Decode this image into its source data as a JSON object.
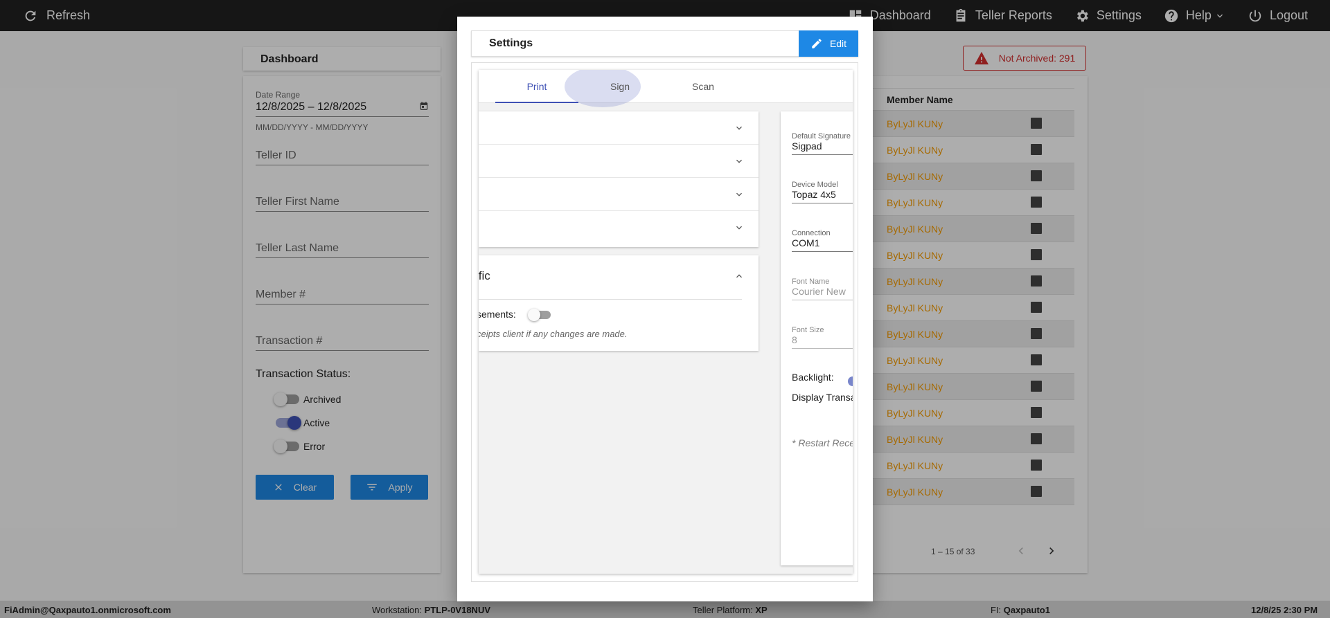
{
  "topbar": {
    "refresh_label": "Refresh",
    "nav": [
      {
        "label": "Dashboard",
        "icon": "dashboard-icon"
      },
      {
        "label": "Teller Reports",
        "icon": "clipboard-icon"
      },
      {
        "label": "Settings",
        "icon": "gear-icon"
      },
      {
        "label": "Help",
        "icon": "help-icon"
      },
      {
        "label": "Logout",
        "icon": "power-icon"
      }
    ]
  },
  "dashboard": {
    "title": "Dashboard",
    "date_range_label": "Date Range",
    "date_range_value": "12/8/2025 – 12/8/2025",
    "date_range_hint": "MM/DD/YYYY - MM/DD/YYYY",
    "teller_id": "Teller ID",
    "teller_first": "Teller First Name",
    "teller_last": "Teller Last Name",
    "member_no": "Member #",
    "transaction_no": "Transaction #",
    "status_title": "Transaction Status:",
    "statuses": [
      {
        "label": "Archived",
        "on": false
      },
      {
        "label": "Active",
        "on": true
      },
      {
        "label": "Error",
        "on": false
      }
    ],
    "clear_label": "Clear",
    "apply_label": "Apply"
  },
  "table": {
    "not_archived": "Not Archived: 291",
    "header": "Member Name",
    "rows": [
      "ByLyJl KUNy",
      "ByLyJl KUNy",
      "ByLyJl KUNy",
      "ByLyJl KUNy",
      "ByLyJl KUNy",
      "ByLyJl KUNy",
      "ByLyJl KUNy",
      "ByLyJl KUNy",
      "ByLyJl KUNy",
      "ByLyJl KUNy",
      "ByLyJl KUNy",
      "ByLyJl KUNy",
      "ByLyJl KUNy",
      "ByLyJl KUNy",
      "ByLyJl KUNy"
    ],
    "pager": "1 – 15 of 33"
  },
  "modal": {
    "title": "Settings",
    "edit_label": "Edit",
    "tabs": [
      "Print",
      "Sign",
      "Scan"
    ],
    "active_tab": "Print",
    "accordion_open_title": "ific",
    "accordion_open_label": "sements:",
    "accordion_open_hint": "ceipts client if any changes are made.",
    "sign": {
      "default_label": "Default Signature D",
      "default_value": "Sigpad",
      "model_label": "Device Model",
      "model_value": "Topaz 4x5",
      "conn_label": "Connection",
      "conn_value": "COM1",
      "font_label": "Font Name",
      "font_value": "Courier New",
      "size_label": "Font Size",
      "size_value": "8",
      "backlight": "Backlight:",
      "display": "Display Transa",
      "restart": "* Restart Rece"
    }
  },
  "footer": {
    "user": "FiAdmin@Qaxpauto1.onmicrosoft.com",
    "workstation_label": "Workstation:",
    "workstation": "PTLP-0V18NUV",
    "platform_label": "Teller Platform:",
    "platform": "XP",
    "fi_label": "FI:",
    "fi": "Qaxpauto1",
    "datetime": "12/8/25 2:30 PM"
  },
  "colors": {
    "accent": "#1e88e5",
    "indigo": "#3f51b5",
    "warning": "#d32f2f",
    "link": "#f59b00"
  }
}
